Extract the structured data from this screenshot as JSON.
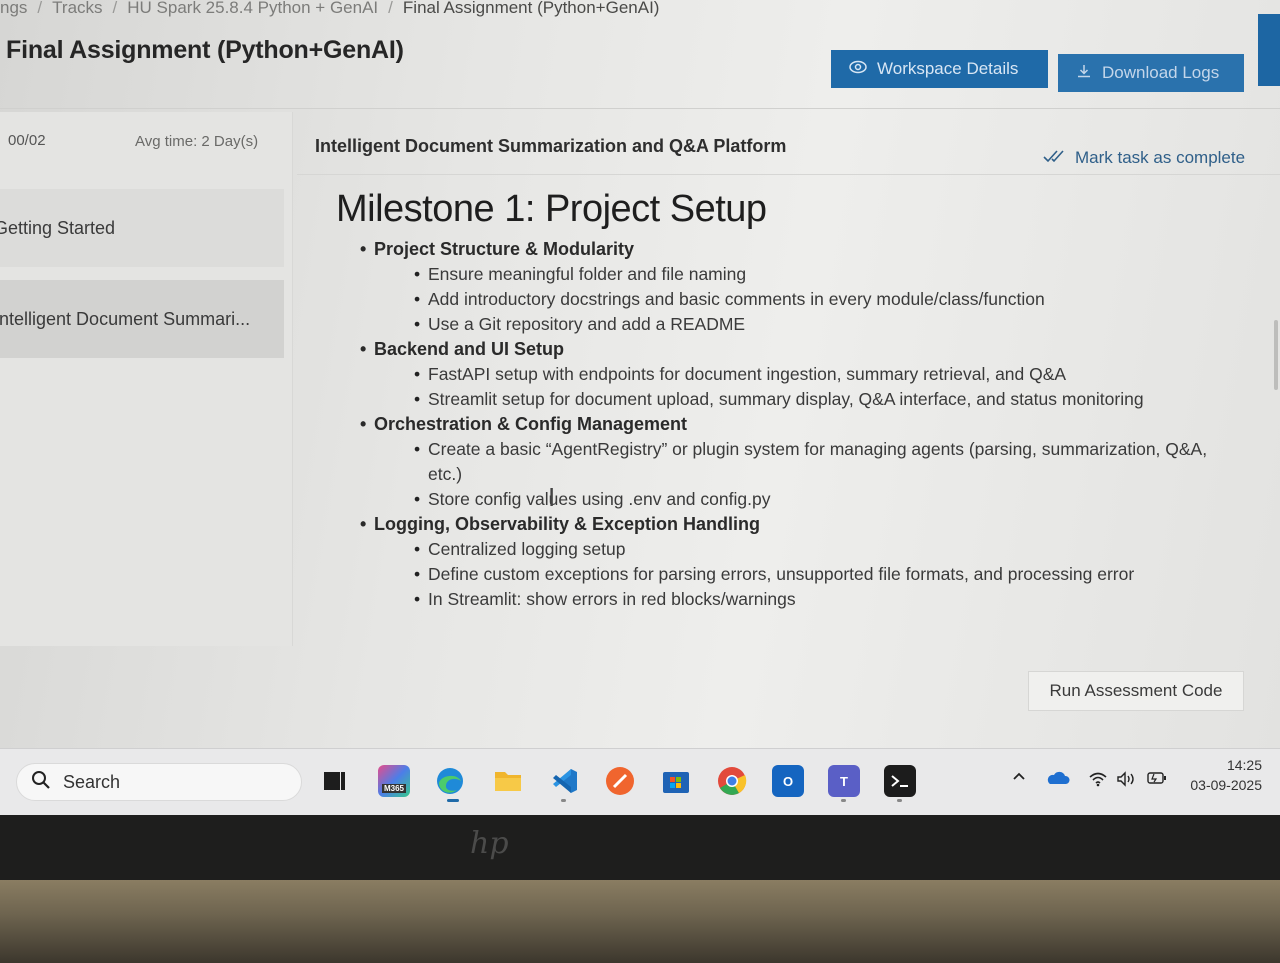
{
  "breadcrumb": {
    "items": [
      "ngs",
      "Tracks",
      "HU Spark 25.8.4 Python + GenAI",
      "Final Assignment (Python+GenAI)"
    ],
    "separator": "/"
  },
  "page": {
    "title": "Final Assignment (Python+GenAI)",
    "workspace_button": "Workspace Details",
    "download_button": "Download Logs"
  },
  "sidebar": {
    "count": "00/02",
    "avg_time": "Avg time: 2 Day(s)",
    "items": [
      {
        "label": "Getting Started"
      },
      {
        "label": "Intelligent Document Summari..."
      }
    ]
  },
  "main": {
    "task_title": "Intelligent Document Summarization and Q&A Platform",
    "mark_complete": "Mark task as complete",
    "milestone_title": "Milestone 1: Project Setup",
    "sections": [
      {
        "heading": "Project Structure & Modularity",
        "points": [
          "Ensure meaningful folder and file naming",
          "Add introductory docstrings and basic comments in every module/class/function",
          "Use a Git repository and add a README"
        ]
      },
      {
        "heading": "Backend and UI Setup",
        "points": [
          "FastAPI setup with endpoints for document ingestion, summary retrieval, and Q&A",
          "Streamlit setup for document upload, summary display, Q&A interface, and status monitoring"
        ]
      },
      {
        "heading": "Orchestration & Config Management",
        "points": [
          "Create a basic “AgentRegistry” or plugin system for managing agents (parsing, summarization, Q&A, etc.)",
          "Store config values using .env and config.py"
        ]
      },
      {
        "heading": "Logging, Observability & Exception Handling",
        "points": [
          "Centralized logging setup",
          "Define custom exceptions for parsing errors, unsupported file formats, and processing error",
          "In Streamlit: show errors in red blocks/warnings"
        ]
      }
    ],
    "run_button": "Run Assessment Code"
  },
  "taskbar": {
    "search_label": "Search",
    "m365_label": "M365",
    "outlook_label": "O",
    "teams_label": "T",
    "time": "14:25",
    "date": "03-09-2025"
  },
  "device": {
    "brand": "hp"
  },
  "colors": {
    "primary_button": "#1f6aa8",
    "link": "#2f5f89"
  }
}
